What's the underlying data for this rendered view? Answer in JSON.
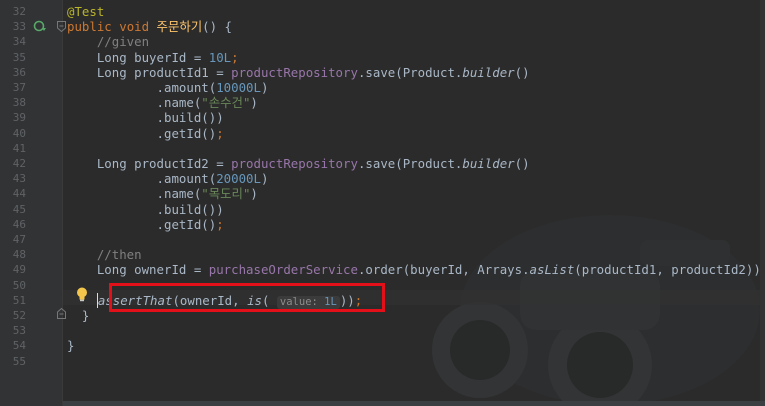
{
  "gutter": {
    "line_numbers": [
      "32",
      "33",
      "34",
      "35",
      "36",
      "37",
      "38",
      "39",
      "40",
      "41",
      "42",
      "43",
      "44",
      "45",
      "46",
      "47",
      "48",
      "49",
      "50",
      "51",
      "52",
      "53",
      "54",
      "55"
    ]
  },
  "code": {
    "l32_annotation": "@Test",
    "l33_public": "public",
    "l33_void": "void",
    "l33_method": "주문하기",
    "l33_rest": "() {",
    "l34_comment": "//given",
    "l35_type": "Long buyerId = ",
    "l35_value": "10L",
    "l35_end": ";",
    "l36_type": "Long productId1 = ",
    "l36_repo": "productRepository",
    "l36_call": ".save(Product.",
    "l36_builder": "builder",
    "l36_end": "()",
    "l37_method": ".amount(",
    "l37_value": "10000L",
    "l37_end": ")",
    "l38_method": ".name(",
    "l38_value": "\"손수건\"",
    "l38_end": ")",
    "l39_text": ".build())",
    "l40_text": ".getId()",
    "l40_end": ";",
    "l42_type": "Long productId2 = ",
    "l42_repo": "productRepository",
    "l42_call": ".save(Product.",
    "l42_builder": "builder",
    "l42_end": "()",
    "l43_method": ".amount(",
    "l43_value": "20000L",
    "l43_end": ")",
    "l44_method": ".name(",
    "l44_value": "\"목도리\"",
    "l44_end": ")",
    "l45_text": ".build())",
    "l46_text": ".getId()",
    "l46_end": ";",
    "l48_comment": "//then",
    "l49_type": "Long ownerId = ",
    "l49_service": "purchaseOrderService",
    "l49_call": ".order(buyerId, Arrays.",
    "l49_aslist": "asList",
    "l49_args": "(productId1, productId2))",
    "l49_end": ";",
    "l51_assert": "assertThat",
    "l51_mid": "(ownerId, ",
    "l51_is": "is",
    "l51_paren": "( ",
    "l51_hint_label": "value:",
    "l51_hint_value": "1L",
    "l51_close": "))",
    "l51_end": ";",
    "l52_text": "}",
    "l54_text": "}"
  },
  "icons": {
    "run_test": "run-test-icon",
    "fold": "fold-icon",
    "intention": "lightbulb-icon"
  },
  "colors": {
    "highlight_border": "#e3101a",
    "keyword": "#cc7832",
    "annotation": "#bbb529",
    "number": "#6897bb",
    "string": "#6a8759",
    "field": "#9876aa"
  }
}
